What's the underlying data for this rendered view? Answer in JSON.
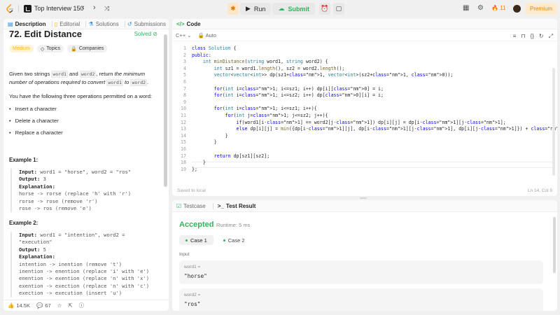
{
  "topbar": {
    "list_title": "Top Interview 150",
    "run_label": "Run",
    "submit_label": "Submit",
    "streak": "11",
    "premium_label": "Premium"
  },
  "left_tabs": [
    {
      "label": "Description",
      "icon": "document-icon"
    },
    {
      "label": "Editorial",
      "icon": "book-icon"
    },
    {
      "label": "Solutions",
      "icon": "flask-icon"
    },
    {
      "label": "Submissions",
      "icon": "history-icon"
    }
  ],
  "problem": {
    "title": "72. Edit Distance",
    "status": "Solved",
    "difficulty": "Medium",
    "topics_label": "Topics",
    "companies_label": "Companies",
    "statement_a": "Given two strings ",
    "word1": "word1",
    "statement_b": " and ",
    "word2": "word2",
    "statement_c": ", return ",
    "statement_em": "the minimum number of operations required to convert ",
    "statement_to": " to ",
    "statement_end": ".",
    "ops_intro": "You have the following three operations permitted on a word:",
    "ops": [
      "Insert a character",
      "Delete a character",
      "Replace a character"
    ],
    "examples": [
      {
        "title": "Example 1:",
        "input_label": "Input:",
        "input": "word1 = \"horse\", word2 = \"ros\"",
        "output_label": "Output:",
        "output": "3",
        "explanation_label": "Explanation:",
        "lines": [
          "horse -> rorse (replace 'h' with 'r')",
          "rorse -> rose (remove 'r')",
          "rose -> ros (remove 'e')"
        ]
      },
      {
        "title": "Example 2:",
        "input_label": "Input:",
        "input": "word1 = \"intention\", word2 =",
        "input_cont": "\"execution\"",
        "output_label": "Output:",
        "output": "5",
        "explanation_label": "Explanation:",
        "lines": [
          "intention -> inention (remove 't')",
          "inention -> enention (replace 'i' with 'e')",
          "enention -> exention (replace 'n' with 'x')",
          "exention -> exection (replace 'n' with 'c')",
          "exection -> execution (insert 'u')"
        ]
      }
    ]
  },
  "left_footer": {
    "likes": "14.5K",
    "comments": "67"
  },
  "code": {
    "tab_label": "Code",
    "language": "C++",
    "mode": "Auto",
    "status_left": "Saved to local",
    "status_right": "Ln 14, Col 9",
    "lines": [
      "class Solution {",
      "public:",
      "    int minDistance(string word1, string word2) {",
      "        int sz1 = word1.length(), sz2 = word2.length();",
      "        vector<vector<int>> dp(sz1+1, vector<int>(sz2+1, 0));",
      "",
      "        for(int i=1; i<=sz1; i++) dp[i][0] = i;",
      "        for(int i=1; i<=sz2; i++) dp[0][i] = i;",
      "",
      "        for(int i=1; i<=sz1; i++){",
      "            for(int j=1; j<=sz2; j++){",
      "                if(word1[i-1] == word2[j-1]) dp[i][j] = dp[i-1][j-1];",
      "                else dp[i][j] = min({dp[i-1][j], dp[i-1][j-1], dp[i][j-1]}) + 1;",
      "            }",
      "        }",
      "",
      "        return dp[sz1][sz2];",
      "    }",
      "};"
    ]
  },
  "result": {
    "tab_testcase": "Testcase",
    "tab_result": "Test Result",
    "verdict": "Accepted",
    "runtime": "Runtime: 5 ms",
    "cases": [
      "Case 1",
      "Case 2"
    ],
    "input_label": "Input",
    "vars": [
      {
        "name": "word1 =",
        "value": "\"horse\""
      },
      {
        "name": "word2 =",
        "value": "\"ros\""
      }
    ]
  },
  "colors": {
    "accent_green": "#2db55d",
    "medium": "#ffb800",
    "premium": "#e08a00"
  }
}
